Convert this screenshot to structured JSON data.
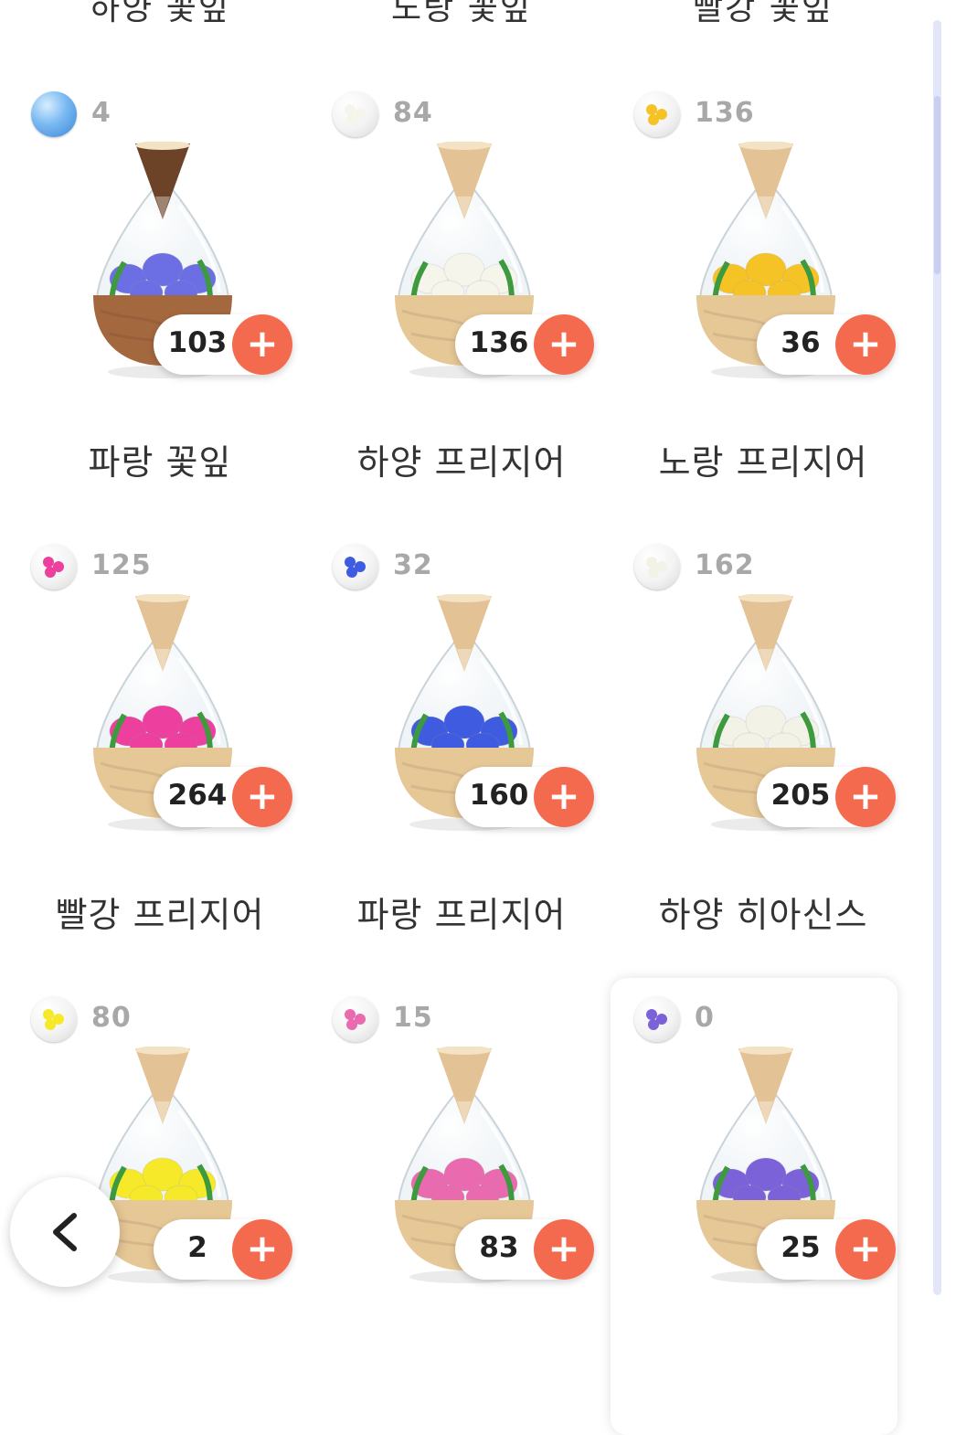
{
  "header": {
    "columns": [
      "하양 꽃잎",
      "노랑 꽃잎",
      "빨강 꽃잎"
    ]
  },
  "items": [
    {
      "seed_icon": "water-drop-icon",
      "seed_count": "4",
      "stock": "103",
      "name": "파랑 꽃잎",
      "flower_color": "#6b6fe3",
      "base": "#a4683f",
      "cap": "#6d4327",
      "selected": false
    },
    {
      "seed_icon": "white-freesia-seed-icon",
      "seed_count": "84",
      "stock": "136",
      "name": "하양 프리지어",
      "flower_color": "#f5f5ec",
      "base": "#e6c796",
      "cap": "#e3c395",
      "selected": false
    },
    {
      "seed_icon": "yellow-freesia-seed-icon",
      "seed_count": "136",
      "stock": "36",
      "name": "노랑 프리지어",
      "flower_color": "#f6c326",
      "base": "#e6c796",
      "cap": "#e3c395",
      "selected": false
    },
    {
      "seed_icon": "red-freesia-seed-icon",
      "seed_count": "125",
      "stock": "264",
      "name": "빨강 프리지어",
      "flower_color": "#ec3f9e",
      "base": "#e6c796",
      "cap": "#e3c395",
      "selected": false
    },
    {
      "seed_icon": "blue-freesia-seed-icon",
      "seed_count": "32",
      "stock": "160",
      "name": "파랑 프리지어",
      "flower_color": "#3f5be0",
      "base": "#e6c796",
      "cap": "#e3c395",
      "selected": false
    },
    {
      "seed_icon": "white-hyacinth-seed-icon",
      "seed_count": "162",
      "stock": "205",
      "name": "하양 히아신스",
      "flower_color": "#f2f2e6",
      "base": "#e6c796",
      "cap": "#e3c395",
      "selected": false
    },
    {
      "seed_icon": "yellow-hyacinth-seed-icon",
      "seed_count": "80",
      "stock": "2",
      "name": "",
      "flower_color": "#f5e92a",
      "base": "#e6c796",
      "cap": "#e3c395",
      "selected": false
    },
    {
      "seed_icon": "pink-hyacinth-seed-icon",
      "seed_count": "15",
      "stock": "83",
      "name": "",
      "flower_color": "#e96aaf",
      "base": "#e6c796",
      "cap": "#e3c395",
      "selected": false
    },
    {
      "seed_icon": "purple-hyacinth-seed-icon",
      "seed_count": "0",
      "stock": "25",
      "name": "",
      "flower_color": "#7b62d8",
      "base": "#e6c796",
      "cap": "#e3c395",
      "selected": true
    }
  ],
  "plus_label": "+",
  "colors": {
    "accent": "#f46a4e",
    "scroll_track": "#e3e6f9",
    "scroll_thumb": "#c9cff1"
  }
}
